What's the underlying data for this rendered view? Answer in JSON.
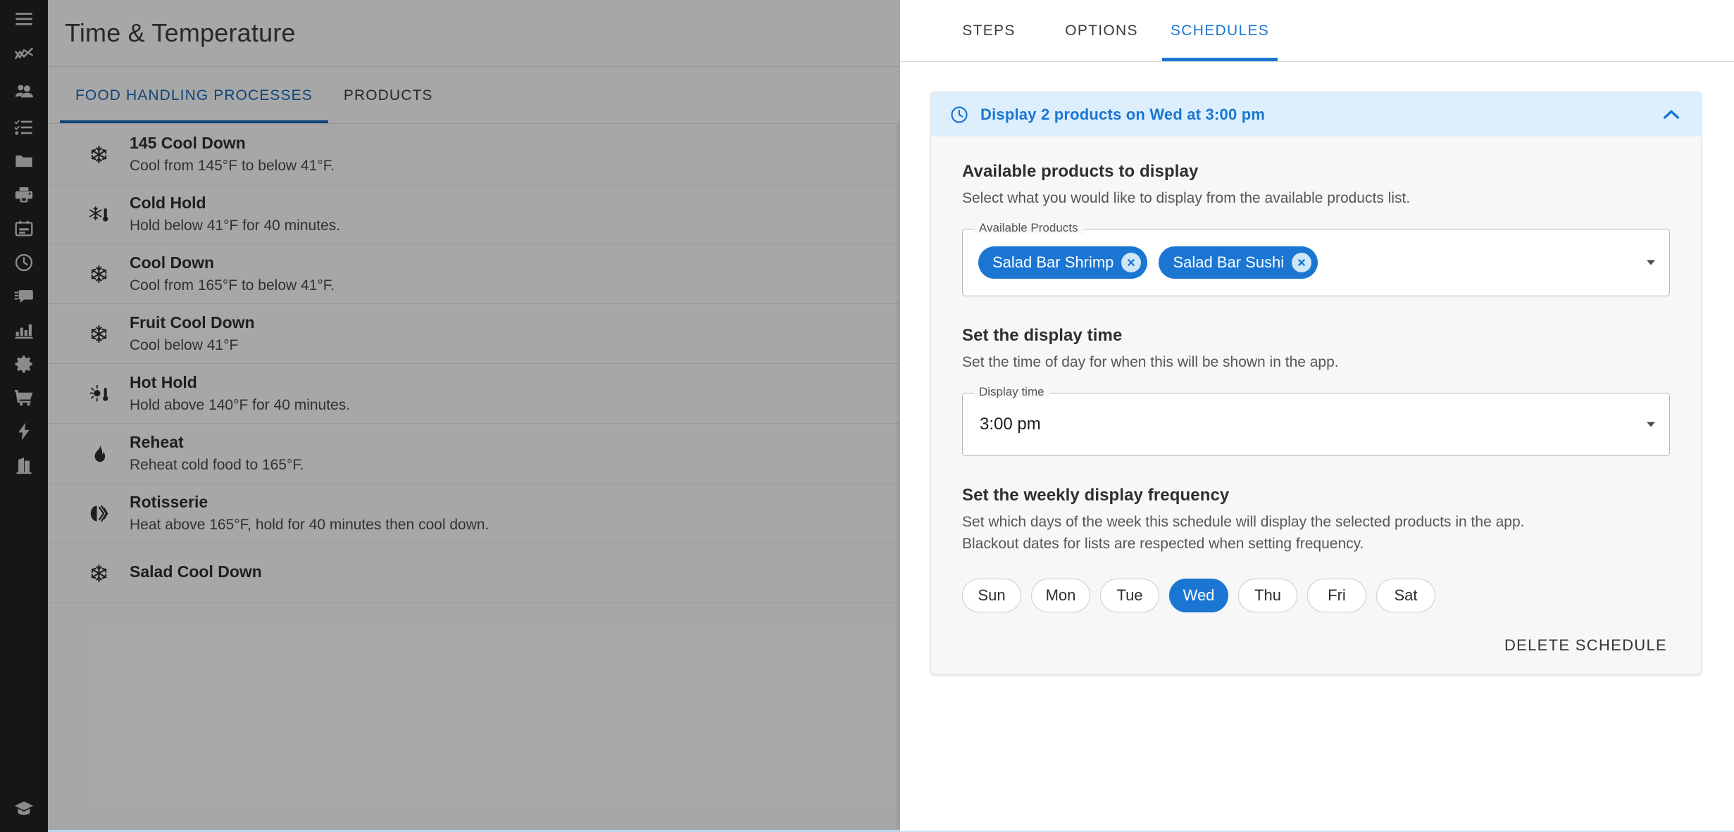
{
  "sidebar": {
    "items": [
      {
        "icon": "hamburger-menu-icon",
        "name": "menu"
      },
      {
        "icon": "analytics-line-chart-icon",
        "name": "analytics"
      },
      {
        "icon": "users-group-icon",
        "name": "users"
      },
      {
        "icon": "checklist-icon",
        "name": "checklists"
      },
      {
        "icon": "folder-icon",
        "name": "folders"
      },
      {
        "icon": "printer-icon",
        "name": "printers"
      },
      {
        "icon": "label-card-icon",
        "name": "labels"
      },
      {
        "icon": "clock-icon",
        "name": "time-and-temperature"
      },
      {
        "icon": "message-bubble-icon",
        "name": "messages"
      },
      {
        "icon": "bar-chart-icon",
        "name": "reports"
      },
      {
        "icon": "gear-icon",
        "name": "settings"
      },
      {
        "icon": "shopping-cart-icon",
        "name": "store"
      },
      {
        "icon": "lightning-bolt-icon",
        "name": "automations"
      },
      {
        "icon": "building-icon",
        "name": "locations"
      },
      {
        "icon": "graduation-cap-icon",
        "name": "training"
      }
    ]
  },
  "page": {
    "title": "Time & Temperature",
    "tabs": [
      {
        "label": "FOOD HANDLING PROCESSES",
        "active": true
      },
      {
        "label": "PRODUCTS",
        "active": false
      }
    ],
    "processes": [
      {
        "icon": "snowflake-icon",
        "name": "145 Cool Down",
        "desc": "Cool from 145°F to below 41°F."
      },
      {
        "icon": "snowflake-thermometer-icon",
        "name": "Cold Hold",
        "desc": "Hold below 41°F for 40 minutes."
      },
      {
        "icon": "snowflake-icon",
        "name": "Cool Down",
        "desc": "Cool from 165°F to below 41°F."
      },
      {
        "icon": "snowflake-icon",
        "name": "Fruit Cool Down",
        "desc": "Cool below 41°F"
      },
      {
        "icon": "sun-thermometer-icon",
        "name": "Hot Hold",
        "desc": "Hold above 140°F for 40 minutes."
      },
      {
        "icon": "flame-icon",
        "name": "Reheat",
        "desc": "Reheat cold food to 165°F."
      },
      {
        "icon": "rotisserie-icon",
        "name": "Rotisserie",
        "desc": "Heat above 165°F, hold for 40 minutes then cool down."
      },
      {
        "icon": "snowflake-icon",
        "name": "Salad Cool Down",
        "desc": ""
      }
    ]
  },
  "panel": {
    "tabs": [
      {
        "label": "STEPS",
        "active": false
      },
      {
        "label": "OPTIONS",
        "active": false
      },
      {
        "label": "SCHEDULES",
        "active": true
      }
    ],
    "schedule": {
      "header_icon": "clock-icon",
      "header_title": "Display 2 products on Wed at 3:00 pm",
      "collapse_icon": "chevron-up-icon",
      "products_section": {
        "title": "Available products to display",
        "subtitle": "Select what you would like to display from the available products list.",
        "field_legend": "Available Products",
        "chips": [
          "Salad Bar Shrimp",
          "Salad Bar Sushi"
        ],
        "chip_remove_icon": "close-circle-icon",
        "dropdown_icon": "caret-down-icon"
      },
      "time_section": {
        "title": "Set the display time",
        "subtitle": "Set the time of day for when this will be shown in the app.",
        "field_legend": "Display time",
        "value": "3:00 pm",
        "dropdown_icon": "caret-down-icon"
      },
      "frequency_section": {
        "title": "Set the weekly display frequency",
        "subtitle_line1": "Set which days of the week this schedule will display the selected products in the app.",
        "subtitle_line2": "Blackout dates for lists are respected when setting frequency.",
        "days": [
          {
            "label": "Sun",
            "selected": false
          },
          {
            "label": "Mon",
            "selected": false
          },
          {
            "label": "Tue",
            "selected": false
          },
          {
            "label": "Wed",
            "selected": true
          },
          {
            "label": "Thu",
            "selected": false
          },
          {
            "label": "Fri",
            "selected": false
          },
          {
            "label": "Sat",
            "selected": false
          }
        ]
      },
      "delete_label": "DELETE SCHEDULE"
    }
  },
  "colors": {
    "accent_blue": "#1a76d2",
    "header_blue_bg": "#ddeffc",
    "rail_dark": "#212121",
    "chip_blue": "#1a76d2"
  }
}
